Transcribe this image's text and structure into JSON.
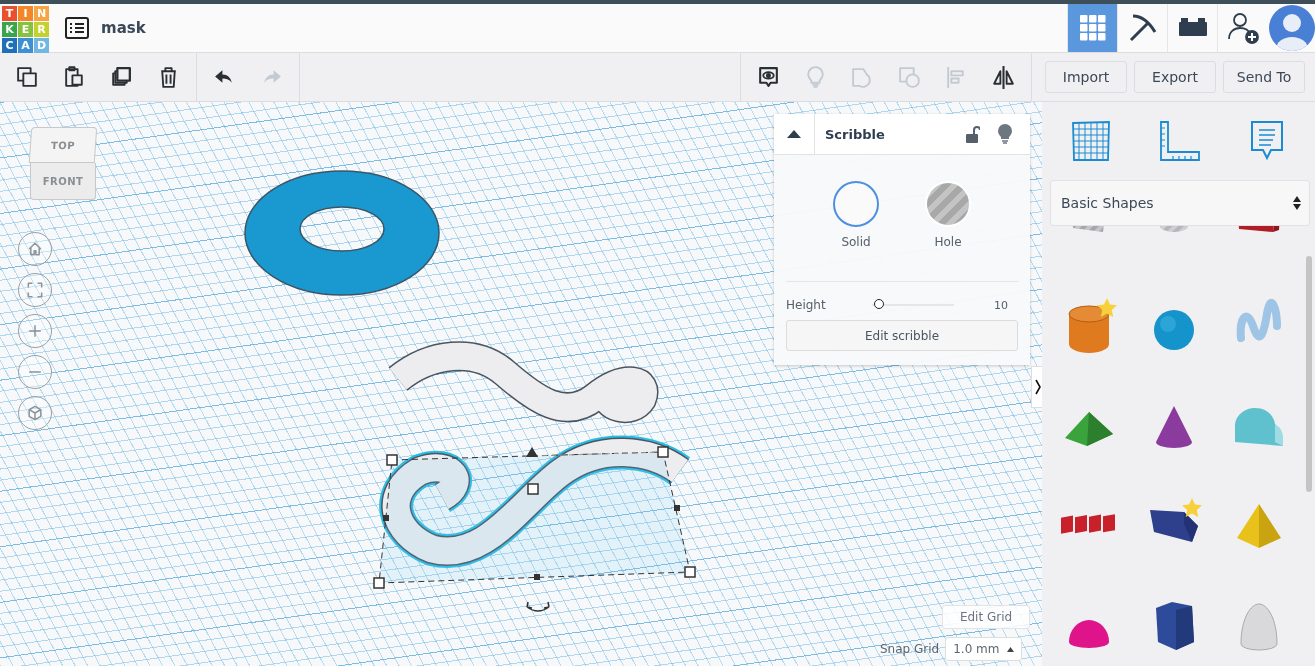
{
  "logo": {
    "letters": [
      {
        "char": "T",
        "color": "#e8502e"
      },
      {
        "char": "I",
        "color": "#f2872a"
      },
      {
        "char": "N",
        "color": "#f7a445"
      },
      {
        "char": "K",
        "color": "#3aa64a"
      },
      {
        "char": "E",
        "color": "#86c13f"
      },
      {
        "char": "R",
        "color": "#c3d22f"
      },
      {
        "char": "C",
        "color": "#1f6fb9"
      },
      {
        "char": "A",
        "color": "#3d90d2"
      },
      {
        "char": "D",
        "color": "#70b8e2"
      }
    ]
  },
  "title": "mask",
  "view_tabs": [
    {
      "kind": "grid",
      "selected": true
    },
    {
      "kind": "pickaxe",
      "selected": false
    },
    {
      "kind": "bricks",
      "selected": false
    },
    {
      "kind": "invite",
      "selected": false
    }
  ],
  "edit_tools": [
    {
      "kind": "copy",
      "disabled": false
    },
    {
      "kind": "paste",
      "disabled": false
    },
    {
      "kind": "duplicate",
      "disabled": false
    },
    {
      "kind": "delete",
      "disabled": false
    }
  ],
  "history_tools": [
    {
      "kind": "undo",
      "disabled": false
    },
    {
      "kind": "redo",
      "disabled": true
    }
  ],
  "shape_tools": [
    {
      "kind": "notes",
      "disabled": false
    },
    {
      "kind": "bulb",
      "disabled": true
    },
    {
      "kind": "group",
      "disabled": true
    },
    {
      "kind": "hole",
      "disabled": true
    },
    {
      "kind": "align",
      "disabled": true
    },
    {
      "kind": "mirror",
      "disabled": false
    }
  ],
  "actions": [
    "Import",
    "Export",
    "Send To"
  ],
  "view_cube": {
    "top": "TOP",
    "front": "FRONT"
  },
  "nav_controls": [
    {
      "kind": "home"
    },
    {
      "kind": "fit"
    },
    {
      "kind": "zoomin"
    },
    {
      "kind": "zoomout"
    },
    {
      "kind": "perspective"
    }
  ],
  "scene": {
    "objects": [
      {
        "kind": "torus",
        "selected": false
      },
      {
        "kind": "scribble",
        "selected": false
      },
      {
        "kind": "scribble",
        "selected": true
      }
    ]
  },
  "inspector": {
    "title": "Scribble",
    "options": [
      {
        "label": "Solid",
        "kind": "solid",
        "selected": true
      },
      {
        "label": "Hole",
        "kind": "hole",
        "selected": false
      }
    ],
    "height": {
      "label": "Height",
      "level": 0.03,
      "reading": "10"
    },
    "button": "Edit scribble"
  },
  "grid": {
    "edit_button": "Edit Grid",
    "snap_label": "Snap Grid",
    "snap_value": "1.0 mm"
  },
  "library": {
    "tools": [
      {
        "kind": "workplane"
      },
      {
        "kind": "ruler"
      },
      {
        "kind": "notes"
      }
    ],
    "category": "Basic Shapes",
    "shapes": [
      {
        "kind": "hollowbox",
        "color": "#a4a6aa"
      },
      {
        "kind": "hollowcylinder",
        "color": "#b4b6ba"
      },
      {
        "kind": "box",
        "color": "#b01d27"
      },
      {
        "kind": "cylinder",
        "color": "#df7a1e",
        "favorite": true
      },
      {
        "kind": "sphere",
        "color": "#1593cb",
        "favorite": false
      },
      {
        "kind": "scribble",
        "color": "#9ec4e6",
        "favorite": false
      },
      {
        "kind": "roof",
        "color": "#3aa33c",
        "favorite": false
      },
      {
        "kind": "cone",
        "color": "#8b3b9e",
        "favorite": false
      },
      {
        "kind": "roundroof",
        "color": "#5fc1cd",
        "favorite": false
      },
      {
        "kind": "text",
        "color": "#c8212b",
        "favorite": false
      },
      {
        "kind": "wedge",
        "color": "#2e3f8c",
        "favorite": true
      },
      {
        "kind": "pyramid",
        "color": "#e8c21b",
        "favorite": false
      },
      {
        "kind": "halfsphere",
        "color": "#df148b",
        "favorite": false
      },
      {
        "kind": "polygon",
        "color": "#2e4a9b",
        "favorite": false
      },
      {
        "kind": "paraboloid",
        "color": "#d9d9db",
        "favorite": false
      }
    ]
  }
}
